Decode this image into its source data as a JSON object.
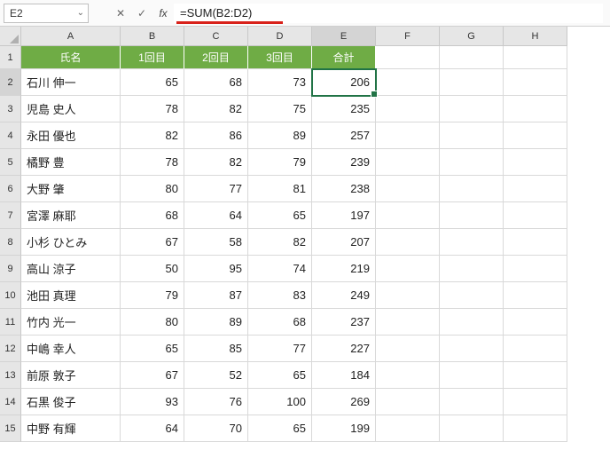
{
  "nameBox": "E2",
  "formula": "=SUM(B2:D2)",
  "columns": [
    "A",
    "B",
    "C",
    "D",
    "E",
    "F",
    "G",
    "H"
  ],
  "colWidths": [
    "wA",
    "wB",
    "wC",
    "wD",
    "wE",
    "wF",
    "wG",
    "wH"
  ],
  "activeCol": "E",
  "activeRow": 2,
  "headers": {
    "name": "氏名",
    "r1": "1回目",
    "r2": "2回目",
    "r3": "3回目",
    "total": "合計"
  },
  "rows": [
    {
      "name": "石川 伸一",
      "r1": 65,
      "r2": 68,
      "r3": 73,
      "total": 206
    },
    {
      "name": "児島 史人",
      "r1": 78,
      "r2": 82,
      "r3": 75,
      "total": 235
    },
    {
      "name": "永田 優也",
      "r1": 82,
      "r2": 86,
      "r3": 89,
      "total": 257
    },
    {
      "name": "橘野 豊",
      "r1": 78,
      "r2": 82,
      "r3": 79,
      "total": 239
    },
    {
      "name": "大野 肇",
      "r1": 80,
      "r2": 77,
      "r3": 81,
      "total": 238
    },
    {
      "name": "宮澤 麻耶",
      "r1": 68,
      "r2": 64,
      "r3": 65,
      "total": 197
    },
    {
      "name": "小杉 ひとみ",
      "r1": 67,
      "r2": 58,
      "r3": 82,
      "total": 207
    },
    {
      "name": "高山 涼子",
      "r1": 50,
      "r2": 95,
      "r3": 74,
      "total": 219
    },
    {
      "name": "池田 真理",
      "r1": 79,
      "r2": 87,
      "r3": 83,
      "total": 249
    },
    {
      "name": "竹内 光一",
      "r1": 80,
      "r2": 89,
      "r3": 68,
      "total": 237
    },
    {
      "name": "中嶋 幸人",
      "r1": 65,
      "r2": 85,
      "r3": 77,
      "total": 227
    },
    {
      "name": "前原 敦子",
      "r1": 67,
      "r2": 52,
      "r3": 65,
      "total": 184
    },
    {
      "name": "石黒 俊子",
      "r1": 93,
      "r2": 76,
      "r3": 100,
      "total": 269
    },
    {
      "name": "中野 有輝",
      "r1": 64,
      "r2": 70,
      "r3": 65,
      "total": 199
    }
  ]
}
